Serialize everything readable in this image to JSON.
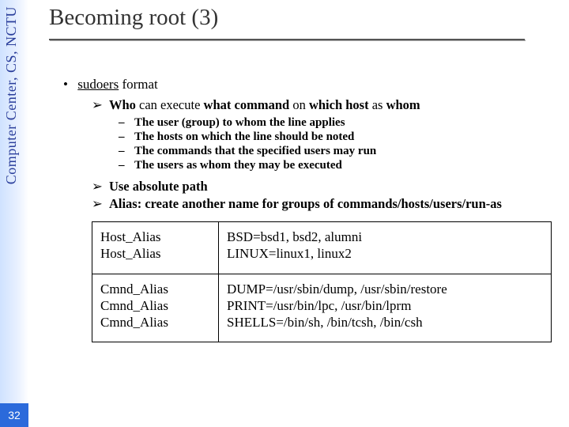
{
  "sidebar": {
    "org": "Computer Center, CS, NCTU"
  },
  "page": {
    "number": "32"
  },
  "title": "Becoming root (3)",
  "b1": {
    "label": "sudoers",
    "tail": " format"
  },
  "who_line": {
    "pre": "Who",
    "mid1": " can execute ",
    "b1": "what command",
    "mid2": " on ",
    "b2": "which host",
    "mid3": " as ",
    "b3": "whom"
  },
  "dash": {
    "d1": "The user (group) to whom the line applies",
    "d2": "The hosts on which the line should be noted",
    "d3": "The commands that the specified users may run",
    "d4": "The users as whom they may be executed"
  },
  "rule2": "Use absolute path",
  "rule3": "Alias: create another name for groups of commands/hosts/users/run-as",
  "table": {
    "r1c1a": "Host_Alias",
    "r1c1b": "Host_Alias",
    "r1c2a": "BSD=bsd1, bsd2, alumni",
    "r1c2b": "LINUX=linux1, linux2",
    "r2c1a": "Cmnd_Alias",
    "r2c1b": "Cmnd_Alias",
    "r2c1c": "Cmnd_Alias",
    "r2c2a": "DUMP=/usr/sbin/dump, /usr/sbin/restore",
    "r2c2b": "PRINT=/usr/bin/lpc, /usr/bin/lprm",
    "r2c2c": "SHELLS=/bin/sh, /bin/tcsh, /bin/csh"
  }
}
